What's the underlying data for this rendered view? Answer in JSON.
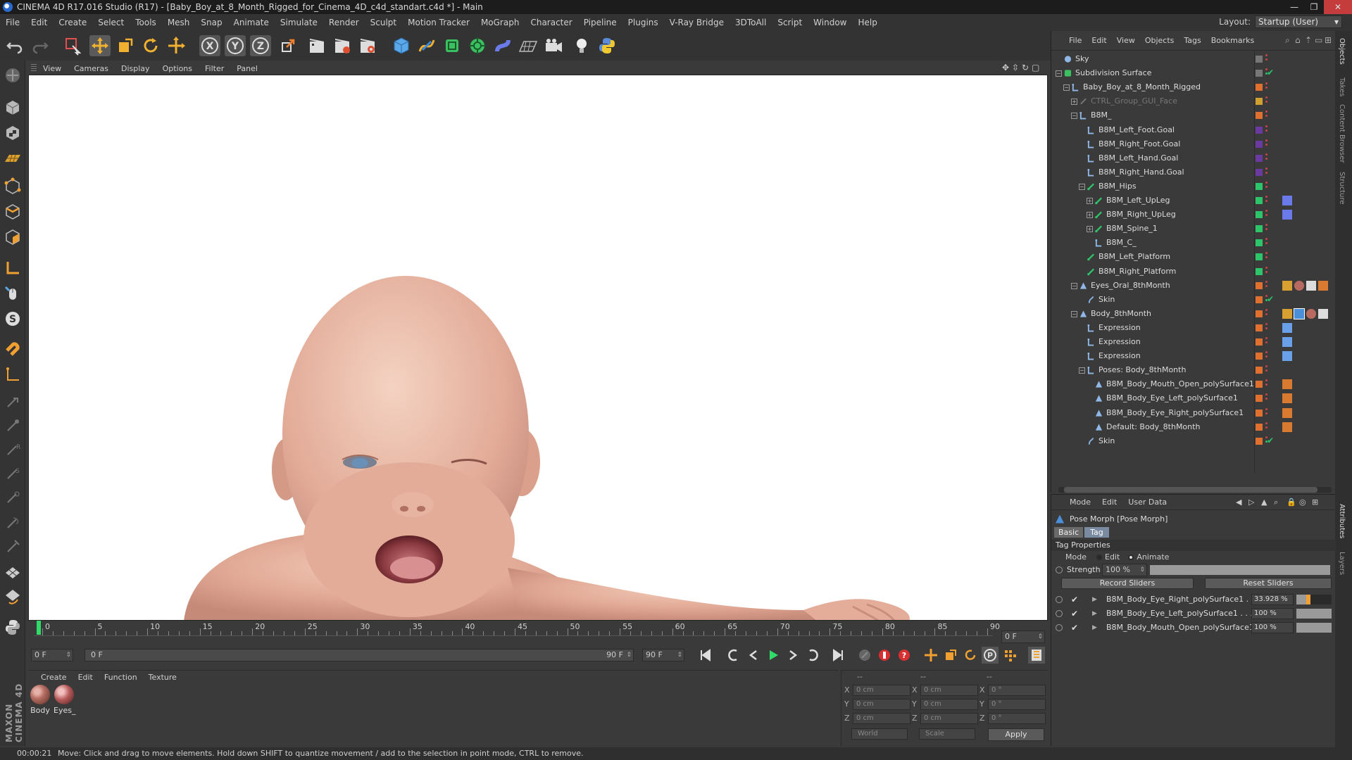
{
  "window": {
    "title": "CINEMA 4D R17.016 Studio (R17) - [Baby_Boy_at_8_Month_Rigged_for_Cinema_4D_c4d_standart.c4d *] - Main"
  },
  "menubar": [
    "File",
    "Edit",
    "Create",
    "Select",
    "Tools",
    "Mesh",
    "Snap",
    "Animate",
    "Simulate",
    "Render",
    "Sculpt",
    "Motion Tracker",
    "MoGraph",
    "Character",
    "Pipeline",
    "Plugins",
    "V-Ray Bridge",
    "3DToAll",
    "Script",
    "Window",
    "Help"
  ],
  "layout": {
    "label": "Layout:",
    "value": "Startup (User)"
  },
  "viewport": {
    "menu": [
      "View",
      "Cameras",
      "Display",
      "Options",
      "Filter",
      "Panel"
    ]
  },
  "timeline": {
    "ticks": [
      "0",
      "5",
      "10",
      "15",
      "20",
      "25",
      "30",
      "35",
      "40",
      "45",
      "50",
      "55",
      "60",
      "65",
      "70",
      "75",
      "80",
      "85",
      "90"
    ],
    "current_frame": "0 F",
    "start_field": "0 F",
    "range_start": "0 F",
    "range_end": "90 F",
    "end_field": "90 F"
  },
  "materials": {
    "menu": [
      "Create",
      "Edit",
      "Function",
      "Texture"
    ],
    "items": [
      "Body",
      "Eyes_"
    ]
  },
  "coords": {
    "header": [
      "--",
      "--",
      "--"
    ],
    "rows": [
      {
        "l1": "X",
        "v1": "0 cm",
        "l2": "X",
        "v2": "0 cm",
        "l3": "X",
        "v3": "0 °"
      },
      {
        "l1": "Y",
        "v1": "0 cm",
        "l2": "Y",
        "v2": "0 cm",
        "l3": "Y",
        "v3": "0 °"
      },
      {
        "l1": "Z",
        "v1": "0 cm",
        "l2": "Z",
        "v2": "0 cm",
        "l3": "Z",
        "v3": "0 °"
      }
    ],
    "world": "World",
    "scale": "Scale",
    "apply": "Apply"
  },
  "status": {
    "time": "00:00:21",
    "message": "Move: Click and drag to move elements. Hold down SHIFT to quantize movement / add to the selection in point mode, CTRL to remove."
  },
  "object_manager": {
    "menu": [
      "File",
      "Edit",
      "View",
      "Objects",
      "Tags",
      "Bookmarks"
    ],
    "items": [
      {
        "name": "Sky",
        "depth": 0,
        "icon": "sky",
        "tag": "#777777"
      },
      {
        "name": "Subdivision Surface",
        "depth": 0,
        "icon": "subdiv",
        "tag": "#777777"
      },
      {
        "name": "Baby_Boy_at_8_Month_Rigged",
        "depth": 1,
        "icon": "null",
        "tag": "#e07030"
      },
      {
        "name": "CTRL_Group_GUI_Face",
        "depth": 2,
        "icon": "joint",
        "tag": "#d0a030",
        "dim": true
      },
      {
        "name": "B8M_",
        "depth": 2,
        "icon": "null",
        "tag": "#e07030"
      },
      {
        "name": "B8M_Left_Foot.Goal",
        "depth": 3,
        "icon": "null",
        "tag": "#6a3aa0"
      },
      {
        "name": "B8M_Right_Foot.Goal",
        "depth": 3,
        "icon": "null",
        "tag": "#6a3aa0"
      },
      {
        "name": "B8M_Left_Hand.Goal",
        "depth": 3,
        "icon": "null",
        "tag": "#6a3aa0"
      },
      {
        "name": "B8M_Right_Hand.Goal",
        "depth": 3,
        "icon": "null",
        "tag": "#6a3aa0"
      },
      {
        "name": "B8M_Hips",
        "depth": 3,
        "icon": "bone",
        "tag": "#2ec46a"
      },
      {
        "name": "B8M_Left_UpLeg",
        "depth": 4,
        "icon": "bone",
        "tag": "#2ec46a"
      },
      {
        "name": "B8M_Right_UpLeg",
        "depth": 4,
        "icon": "bone",
        "tag": "#2ec46a"
      },
      {
        "name": "B8M_Spine_1",
        "depth": 4,
        "icon": "bone",
        "tag": "#2ec46a"
      },
      {
        "name": "B8M_C_",
        "depth": 4,
        "icon": "null",
        "tag": "#2ec46a"
      },
      {
        "name": "B8M_Left_Platform",
        "depth": 3,
        "icon": "bone",
        "tag": "#2ec46a"
      },
      {
        "name": "B8M_Right_Platform",
        "depth": 3,
        "icon": "bone",
        "tag": "#2ec46a"
      },
      {
        "name": "Eyes_Oral_8thMonth",
        "depth": 2,
        "icon": "poly",
        "tag": "#e07030"
      },
      {
        "name": "Skin",
        "depth": 3,
        "icon": "skin",
        "tag": "#e07030"
      },
      {
        "name": "Body_8thMonth",
        "depth": 2,
        "icon": "poly",
        "tag": "#e07030"
      },
      {
        "name": "Expression",
        "depth": 3,
        "icon": "null",
        "tag": "#e07030"
      },
      {
        "name": "Expression",
        "depth": 3,
        "icon": "null",
        "tag": "#e07030"
      },
      {
        "name": "Expression",
        "depth": 3,
        "icon": "null",
        "tag": "#e07030"
      },
      {
        "name": "Poses: Body_8thMonth",
        "depth": 3,
        "icon": "null",
        "tag": "#e07030"
      },
      {
        "name": "B8M_Body_Mouth_Open_polySurface1",
        "depth": 4,
        "icon": "poly",
        "tag": "#e07030"
      },
      {
        "name": "B8M_Body_Eye_Left_polySurface1",
        "depth": 4,
        "icon": "poly",
        "tag": "#e07030"
      },
      {
        "name": "B8M_Body_Eye_Right_polySurface1",
        "depth": 4,
        "icon": "poly",
        "tag": "#e07030"
      },
      {
        "name": "Default: Body_8thMonth",
        "depth": 4,
        "icon": "poly",
        "tag": "#e07030"
      },
      {
        "name": "Skin",
        "depth": 3,
        "icon": "skin",
        "tag": "#e07030"
      }
    ]
  },
  "attributes": {
    "menu": [
      "Mode",
      "Edit",
      "User Data"
    ],
    "title": "Pose Morph [Pose Morph]",
    "tabs": [
      "Basic",
      "Tag"
    ],
    "section": "Tag Properties",
    "mode_label": "Mode",
    "mode_options": [
      "Edit",
      "Animate"
    ],
    "strength_label": "Strength",
    "strength_value": "100 %",
    "record_sliders": "Record Sliders",
    "reset_sliders": "Reset Sliders",
    "morphs": [
      {
        "name": "B8M_Body_Eye_Right_polySurface1 . . . .",
        "value": "33.928 %",
        "fill": 0.33928
      },
      {
        "name": "B8M_Body_Eye_Left_polySurface1 . . . .",
        "value": "100 %",
        "fill": 1.0
      },
      {
        "name": "B8M_Body_Mouth_Open_polySurface1",
        "value": "100 %",
        "fill": 1.0
      }
    ]
  },
  "edge_tabs": [
    "Objects",
    "Takes",
    "Content Browser",
    "Structure",
    "Attributes",
    "Layers"
  ],
  "colors": {
    "accent": "#2fdc6a",
    "tag_blue": "#4a8fd8"
  }
}
